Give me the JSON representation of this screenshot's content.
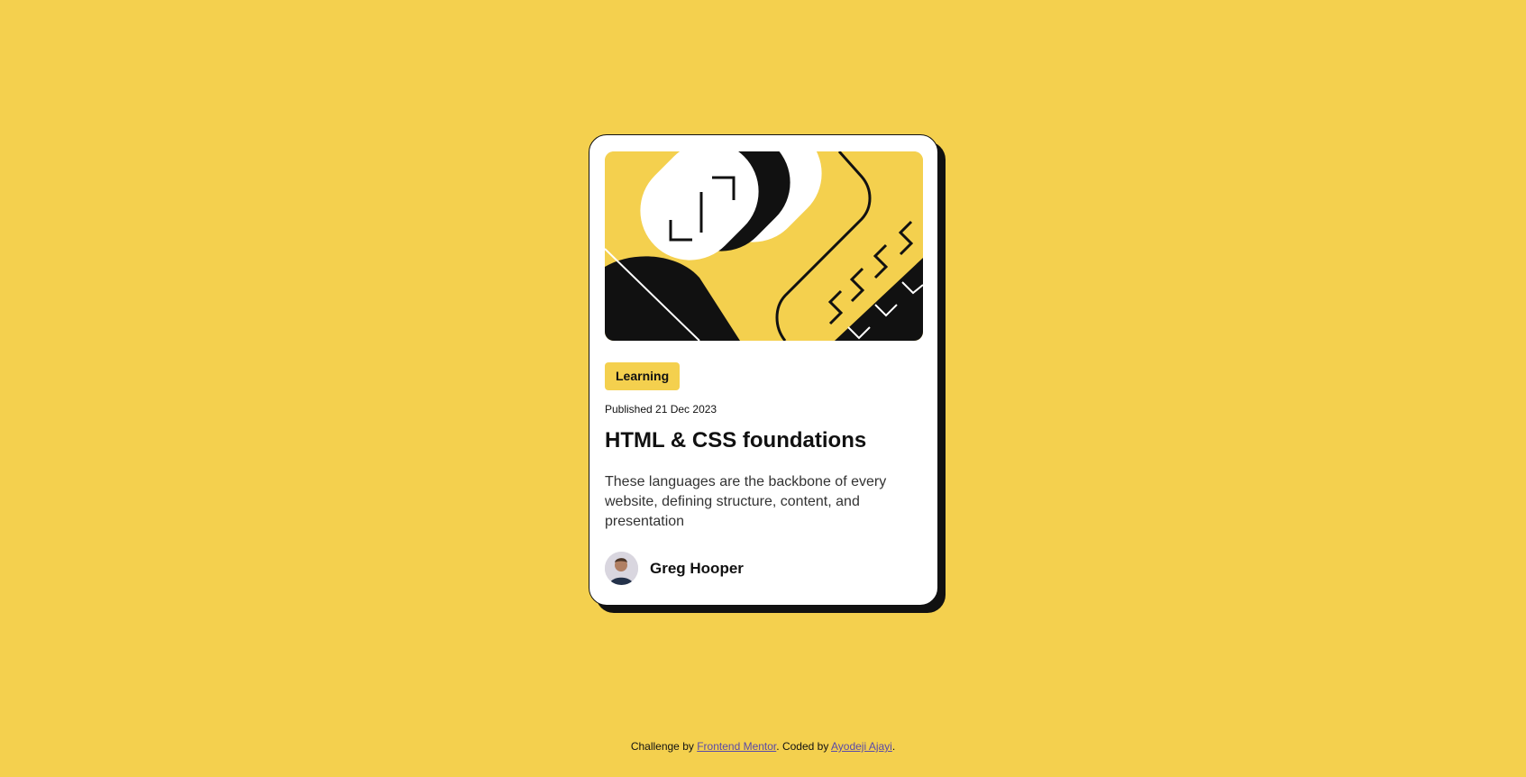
{
  "card": {
    "tag": "Learning",
    "published": "Published 21 Dec 2023",
    "title": "HTML & CSS foundations",
    "description": "These languages are the backbone of every website, defining structure, content, and presentation",
    "author": {
      "name": "Greg Hooper"
    }
  },
  "attribution": {
    "prefix": "Challenge by",
    "link1": "Frontend Mentor",
    "middle": ". Coded by",
    "link2": "Ayodeji Ajayi",
    "suffix": "."
  },
  "colors": {
    "background": "#F4D04E",
    "card": "#FFFFFF",
    "ink": "#111111",
    "link": "#5a4aa8"
  }
}
